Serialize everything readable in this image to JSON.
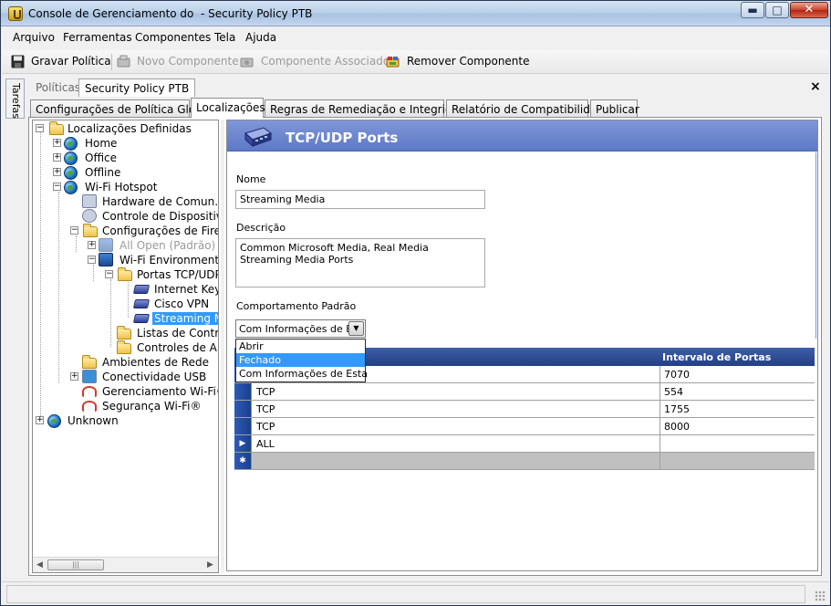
{
  "window": {
    "title": "Console de Gerenciamento do  - Security Policy PTB",
    "min_glyph": "▬",
    "max_glyph": "□",
    "close_glyph": "✕"
  },
  "menu": [
    "Arquivo",
    "Ferramentas",
    "Componentes",
    "Tela",
    "Ajuda"
  ],
  "toolbar": {
    "save": "Gravar Política",
    "new_component": "Novo Componente",
    "associated_component": "Componente Associado",
    "remove_component": "Remover Componente"
  },
  "side_tab": "Tarefas",
  "doc_tabs": {
    "policies": "Políticas",
    "current": "Security Policy PTB",
    "close": "×"
  },
  "tabs": [
    "Configurações de Política Global",
    "Localizações",
    "Regras de Remediação e Integridade",
    "Relatório de Compatibilidade",
    "Publicar"
  ],
  "tree": {
    "expand_plus": "+",
    "expand_minus": "−",
    "root": "Localizações Definidas",
    "home": "Home",
    "office": "Office",
    "offline": "Offline",
    "wifi_hotspot": "Wi-Fi Hotspot",
    "hardware": "Hardware de Comun.",
    "device_control": "Controle de Dispositivo",
    "firewall_config": "Configurações de Firew",
    "all_open": "All Open (Padrão)",
    "wifi_env": "Wi-Fi Environment",
    "ports_folder": "Portas TCP/UDP",
    "internet_key": "Internet Key",
    "cisco_vpn": "Cisco VPN",
    "streaming": "Streaming M",
    "control_lists": "Listas de Control",
    "app_controls": "Controles de Apli",
    "network_envs": "Ambientes de Rede",
    "usb": "Conectividade USB",
    "wifi_mgmt": "Gerenciamento Wi-Fi®",
    "wifi_security": "Segurança Wi-Fi®",
    "unknown": "Unknown",
    "scroll_thumb": "|||",
    "scroll_left": "◀",
    "scroll_right": "▶"
  },
  "panel": {
    "title": "TCP/UDP Ports",
    "name_label": "Nome",
    "name_value": "Streaming Media",
    "desc_label": "Descrição",
    "desc_value": "Common Microsoft Media, Real Media Streaming Media Ports",
    "behavior_label": "Comportamento Padrão",
    "behavior_value": "Com Informações de E",
    "combo_arrow": "▼",
    "dropdown_options": [
      "Abrir",
      "Fechado",
      "Com Informações  de Esta"
    ],
    "grid": {
      "col_ports": "Intervalo de Portas",
      "rows": [
        {
          "protocol": "",
          "ports": "7070"
        },
        {
          "protocol": "TCP",
          "ports": "554"
        },
        {
          "protocol": "TCP",
          "ports": "1755"
        },
        {
          "protocol": "TCP",
          "ports": "8000"
        },
        {
          "protocol": "ALL",
          "ports": ""
        }
      ],
      "current_row_marker": "▶",
      "new_row_marker": "✱"
    }
  },
  "colors": {
    "panel_header": "#6b85cf",
    "grid_header": "#2d4a92",
    "selection": "#3399ff"
  }
}
